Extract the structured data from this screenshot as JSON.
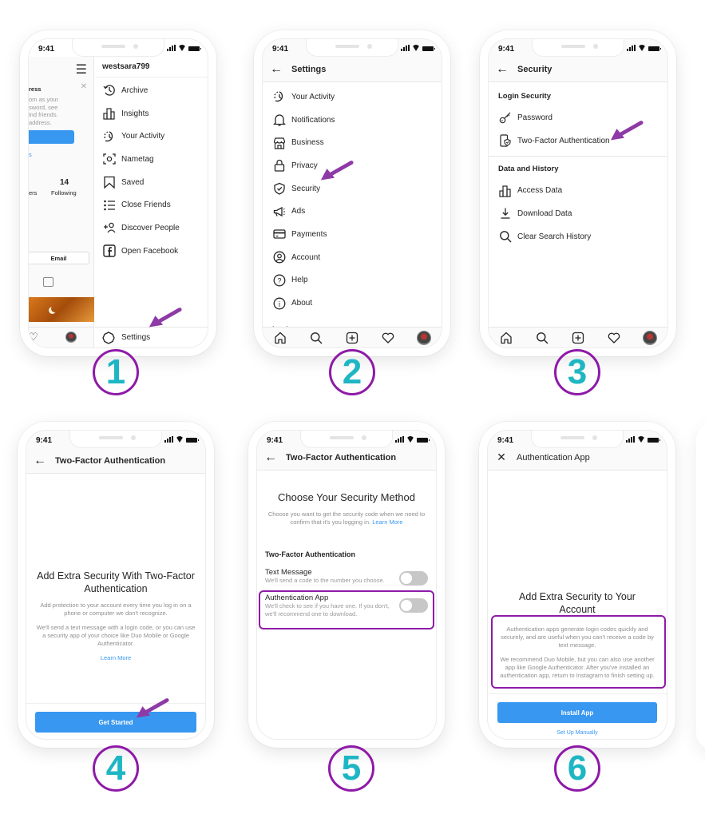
{
  "status_time": "9:41",
  "steps": [
    "1",
    "2",
    "3",
    "4",
    "5",
    "6"
  ],
  "accent_colors": {
    "step_ring": "#8e1aa8",
    "step_number": "#1fb6c4",
    "instagram_blue": "#3897f0",
    "arrow": "#8e3aa6"
  },
  "screen1": {
    "username": "westsara799",
    "profile_peek": {
      "card_title": "ress",
      "card_text": [
        "om as your",
        "sword, see",
        "ind friends.",
        "address."
      ],
      "card_link": "s",
      "followers_label": "ers",
      "following_count": "14",
      "following_label": "Following",
      "email_button": "Email"
    },
    "menu": [
      {
        "icon": "archive-icon",
        "label": "Archive"
      },
      {
        "icon": "insights-icon",
        "label": "Insights"
      },
      {
        "icon": "activity-icon",
        "label": "Your Activity"
      },
      {
        "icon": "nametag-icon",
        "label": "Nametag"
      },
      {
        "icon": "saved-icon",
        "label": "Saved"
      },
      {
        "icon": "close-friends-icon",
        "label": "Close Friends"
      },
      {
        "icon": "discover-people-icon",
        "label": "Discover People"
      },
      {
        "icon": "facebook-icon",
        "label": "Open Facebook"
      }
    ],
    "settings_label": "Settings"
  },
  "screen2": {
    "title": "Settings",
    "items": [
      {
        "icon": "activity-icon",
        "label": "Your Activity"
      },
      {
        "icon": "bell-icon",
        "label": "Notifications"
      },
      {
        "icon": "shop-icon",
        "label": "Business"
      },
      {
        "icon": "lock-icon",
        "label": "Privacy"
      },
      {
        "icon": "shield-icon",
        "label": "Security"
      },
      {
        "icon": "megaphone-icon",
        "label": "Ads"
      },
      {
        "icon": "card-icon",
        "label": "Payments"
      },
      {
        "icon": "account-icon",
        "label": "Account"
      },
      {
        "icon": "help-icon",
        "label": "Help"
      },
      {
        "icon": "info-icon",
        "label": "About"
      }
    ],
    "section_peek": "Logins"
  },
  "screen3": {
    "title": "Security",
    "sections": [
      {
        "header": "Login Security",
        "items": [
          {
            "icon": "key-icon",
            "label": "Password"
          },
          {
            "icon": "phone-shield-icon",
            "label": "Two-Factor Authentication"
          }
        ]
      },
      {
        "header": "Data and History",
        "items": [
          {
            "icon": "insights-icon",
            "label": "Access Data"
          },
          {
            "icon": "download-icon",
            "label": "Download Data"
          },
          {
            "icon": "search-icon",
            "label": "Clear Search History"
          }
        ]
      }
    ]
  },
  "screen4": {
    "title": "Two-Factor Authentication",
    "heading": "Add Extra Security With Two-Factor Authentication",
    "para1": "Add protection to your account every time you log in on a phone or computer we don't recognize.",
    "para2": "We'll send a text message with a login code, or you can use a security app of your choice like Duo Mobile or Google Authenticator.",
    "learn_more": "Learn More",
    "button": "Get Started"
  },
  "screen5": {
    "title": "Two-Factor Authentication",
    "heading": "Choose Your Security Method",
    "description": "Choose you want to get the security code when we need to confirm that it's you logging in.",
    "learn_more": "Learn More",
    "section_header": "Two-Factor Authentication",
    "options": [
      {
        "label": "Text Message",
        "description": "We'll send a code to the number you choose.",
        "enabled": false
      },
      {
        "label": "Authentication App",
        "description": "We'll check to see if you have one. If you don't, we'll recommend one to download.",
        "enabled": false
      }
    ]
  },
  "screen6": {
    "title": "Authentication App",
    "heading": "Add Extra Security to Your Account",
    "para1": "Authentication apps generate login codes quickly and securely, and are useful when you can't receive a code by text message.",
    "para2": "We recommend Duo Mobile, but you can also use another app like Google Authenticator. After you've installed an authentication app, return to Instagram to finish setting up.",
    "button": "Install App",
    "secondary_link": "Set Up Manually"
  }
}
